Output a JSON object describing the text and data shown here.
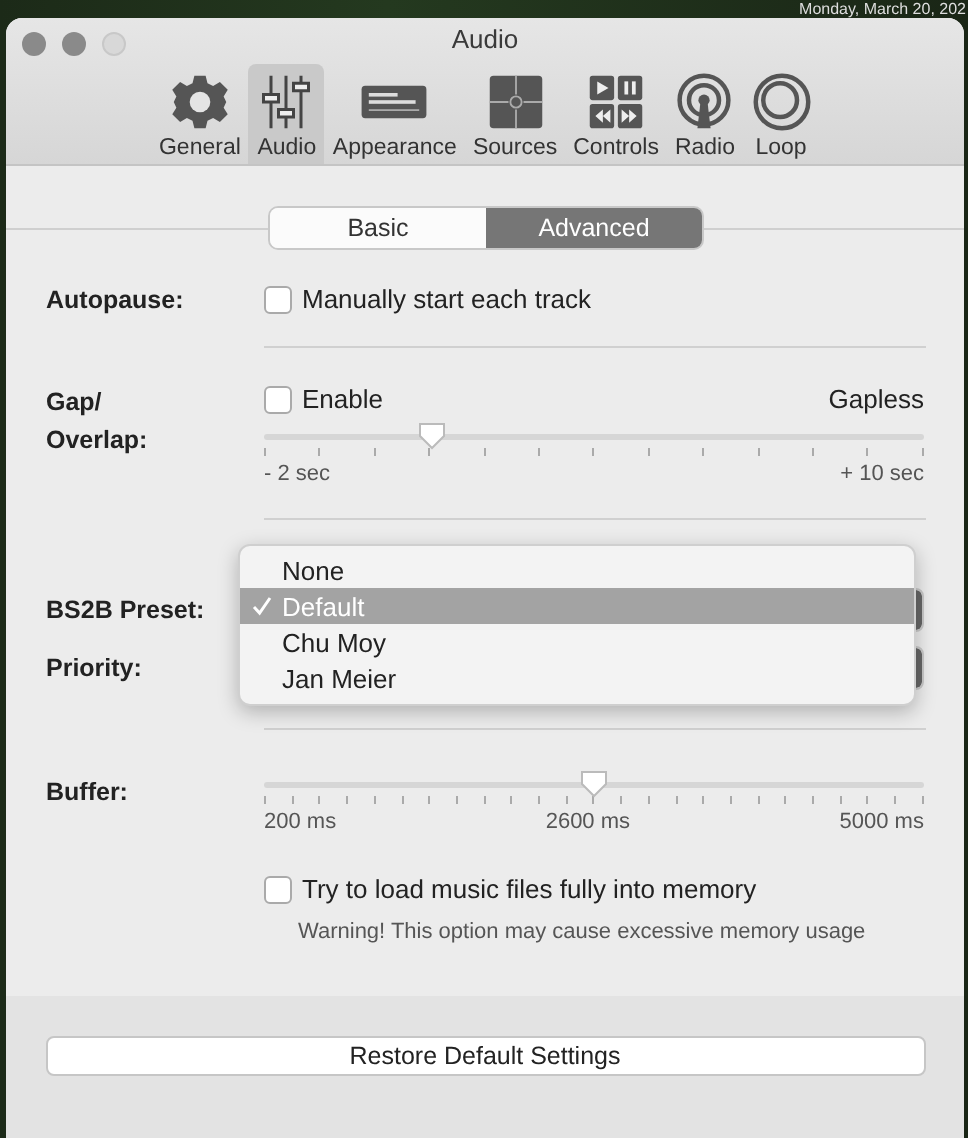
{
  "desktop": {
    "clock": "Monday, March 20, 202"
  },
  "window": {
    "title": "Audio"
  },
  "toolbar": [
    {
      "label": "General",
      "kind": "gear",
      "selected": false
    },
    {
      "label": "Audio",
      "kind": "sliders",
      "selected": true
    },
    {
      "label": "Appearance",
      "kind": "appearance",
      "selected": false
    },
    {
      "label": "Sources",
      "kind": "puzzle",
      "selected": false
    },
    {
      "label": "Controls",
      "kind": "controls",
      "selected": false
    },
    {
      "label": "Radio",
      "kind": "radio",
      "selected": false
    },
    {
      "label": "Loop",
      "kind": "loop",
      "selected": false
    }
  ],
  "segments": [
    {
      "label": "Basic",
      "selected": false
    },
    {
      "label": "Advanced",
      "selected": true
    }
  ],
  "autopause": {
    "label": "Autopause:",
    "checkbox": {
      "label": "Manually start each track",
      "checked": false
    }
  },
  "gap": {
    "label": "Gap/\nOverlap:",
    "checkbox": {
      "label": "Enable",
      "checked": false
    },
    "mode": "Gapless",
    "slider": {
      "level": 0.255,
      "min_label": "- 2 sec",
      "max_label": "+ 10 sec"
    }
  },
  "bs2b": {
    "label": "BS2B Preset:",
    "menu": [
      {
        "label": "None",
        "selected": false
      },
      {
        "label": "Default",
        "selected": true
      },
      {
        "label": "Chu Moy",
        "selected": false
      },
      {
        "label": "Jan Meier",
        "selected": false
      }
    ]
  },
  "priority": {
    "label": "Priority:"
  },
  "buffer": {
    "label": "Buffer:",
    "slider": {
      "level": 0.5,
      "min_label": "200 ms",
      "mid_label": "2600 ms",
      "max_label": "5000 ms"
    },
    "checkbox": {
      "label": "Try to load music files fully into memory",
      "checked": false
    },
    "warning": "Warning! This option may cause excessive memory usage"
  },
  "restore_button": "Restore Default Settings"
}
